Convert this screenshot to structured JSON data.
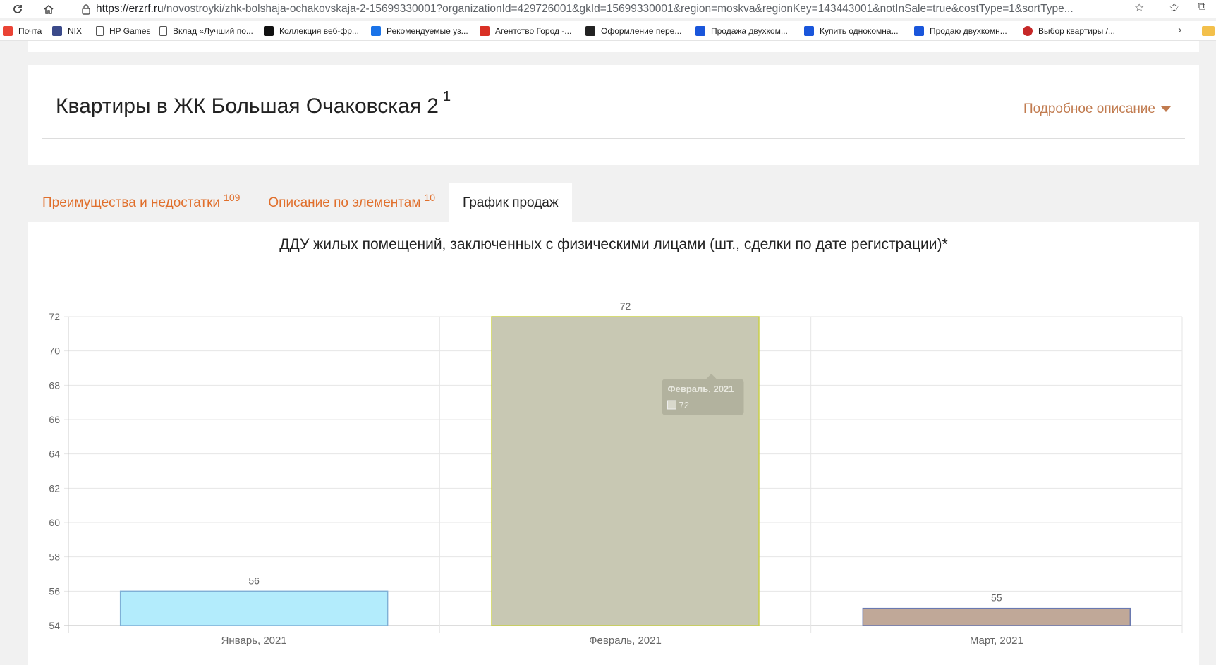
{
  "browser": {
    "url_host": "https://erzrf.ru",
    "url_rest": "/novostroyki/zhk-bolshaja-ochakovskaja-2-15699330001?organizationId=429726001&gkId=15699330001&region=moskva&regionKey=143443001&notInSale=true&costType=1&sortType...",
    "bookmarks": [
      {
        "label": "Почта",
        "icon": "mail-icon",
        "color": "#ea4335"
      },
      {
        "label": "NIX",
        "icon": "nix-icon",
        "color": "#3b4a8a"
      },
      {
        "label": "HP Games",
        "icon": "page-icon",
        "color": "#555555"
      },
      {
        "label": "Вклад «Лучший по...",
        "icon": "page-icon",
        "color": "#555555"
      },
      {
        "label": "Коллекция веб-фр...",
        "icon": "collection-icon",
        "color": "#111111"
      },
      {
        "label": "Рекомендуемые уз...",
        "icon": "bing-icon",
        "color": "#1a73e8"
      },
      {
        "label": "Агентство Город -...",
        "icon": "g-icon",
        "color": "#d93025"
      },
      {
        "label": "Оформление пере...",
        "icon": "plus-icon",
        "color": "#222222"
      },
      {
        "label": "Продажа двухком...",
        "icon": "avito-icon",
        "color": "#1a56db"
      },
      {
        "label": "Купить однокомна...",
        "icon": "avito-icon",
        "color": "#1a56db"
      },
      {
        "label": "Продаю двухкомн...",
        "icon": "avito-icon",
        "color": "#1a56db"
      },
      {
        "label": "Выбор квартиры /...",
        "icon": "circle-icon",
        "color": "#c62828"
      }
    ]
  },
  "header": {
    "title": "Квартиры в ЖК Большая Очаковская 2",
    "title_sup": "1",
    "detail_link": "Подробное описание"
  },
  "tabs": [
    {
      "label": "Преимущества и недостатки",
      "sup": "109",
      "active": false
    },
    {
      "label": "Описание по элементам",
      "sup": "10",
      "active": false
    },
    {
      "label": "График продаж",
      "sup": "",
      "active": true
    }
  ],
  "chart_data": {
    "type": "bar",
    "title": "ДДУ жилых помещений, заключенных с физическими лицами (шт., сделки по дате регистрации)*",
    "categories": [
      "Январь, 2021",
      "Февраль, 2021",
      "Март, 2021"
    ],
    "values": [
      56,
      72,
      55
    ],
    "ylim": [
      54,
      72
    ],
    "yticks": [
      54,
      56,
      58,
      60,
      62,
      64,
      66,
      68,
      70,
      72
    ],
    "grid": true,
    "bar_colors": [
      "#b3ecfc",
      "#c8c8b3",
      "#c0a898"
    ],
    "bar_borders": [
      "#7fb0d6",
      "#c9cf4a",
      "#6a79b0"
    ],
    "tooltip": {
      "title": "Февраль, 2021",
      "value": "72"
    }
  }
}
